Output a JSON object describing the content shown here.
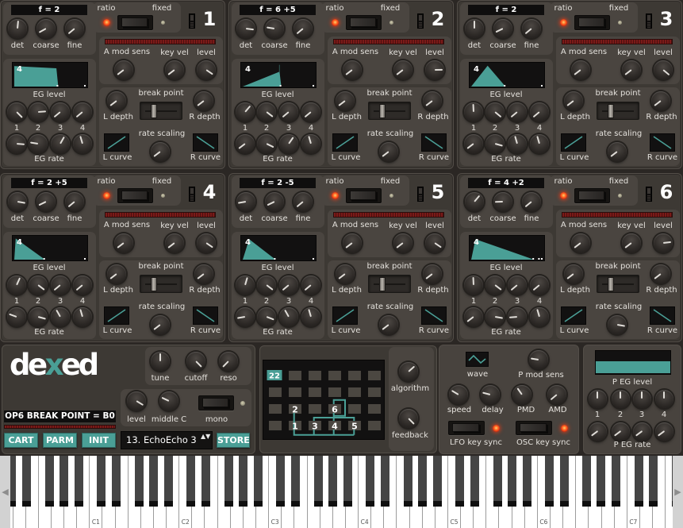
{
  "app": {
    "title": "Dexed"
  },
  "colors": {
    "accent": "#4a9f96",
    "led_on": "#ff4a1e",
    "panel": "#3d3934",
    "subpanel": "#4a4540",
    "display": "#121111"
  },
  "labels": {
    "det": "det",
    "coarse": "coarse",
    "fine": "fine",
    "ratio": "ratio",
    "fixed": "fixed",
    "a_mod_sens": "A mod sens",
    "key_vel": "key vel",
    "level": "level",
    "eg_level": "EG level",
    "eg_rate": "EG rate",
    "stage_numbers": [
      "1",
      "2",
      "3",
      "4"
    ],
    "break_point": "break point",
    "l_depth": "L depth",
    "r_depth": "R depth",
    "rate_scaling": "rate scaling",
    "l_curve": "L curve",
    "r_curve": "R curve"
  },
  "operators": [
    {
      "number": "1",
      "freq_display": "f = 2",
      "mode": "ratio",
      "knobs": {
        "det": 0.52,
        "coarse": 0.06,
        "fine": 0.02,
        "a_mod_sens": 0.03,
        "key_vel": 0.03,
        "level": 0.96,
        "l_depth": 0.03,
        "r_depth": 0.03,
        "rate_scaling": 0.03
      },
      "eg_levels": [
        1.0,
        0.82,
        0.02,
        0.02
      ],
      "eg_rates": [
        0.85,
        0.2,
        0.61,
        0.44
      ],
      "break_point": 0.2,
      "l_curve": "linear-rising",
      "r_curve": "linear-falling",
      "envelope": {
        "stage_label": "4",
        "points": [
          [
            0,
            0
          ],
          [
            0,
            0.92
          ],
          [
            0.59,
            0.82
          ],
          [
            0.615,
            0
          ]
        ],
        "markers": [
          0.615,
          1.0
        ]
      }
    },
    {
      "number": "2",
      "freq_display": "f = 6 +5",
      "mode": "ratio",
      "knobs": {
        "det": 0.86,
        "coarse": 0.2,
        "fine": 0.02,
        "a_mod_sens": 0.03,
        "key_vel": 0.03,
        "level": 0.83,
        "l_depth": 0.03,
        "r_depth": 0.03,
        "rate_scaling": 0.03
      },
      "eg_levels": [
        0.65,
        0.97,
        0.02,
        0.02
      ],
      "eg_rates": [
        0.03,
        0.93,
        0.63,
        0.44
      ],
      "break_point": 0.2,
      "l_curve": "linear-rising",
      "r_curve": "linear-falling",
      "envelope": {
        "stage_label": "4",
        "points": [
          [
            0,
            0
          ],
          [
            0.51,
            0.66
          ],
          [
            0.51,
            0.98
          ],
          [
            0.515,
            0.98
          ],
          [
            0.515,
            0.66
          ],
          [
            0.54,
            0
          ]
        ],
        "markers": [
          0.54,
          1.0
        ]
      }
    },
    {
      "number": "3",
      "freq_display": "f = 2",
      "mode": "ratio",
      "knobs": {
        "det": 0.5,
        "coarse": 0.07,
        "fine": 0.02,
        "a_mod_sens": 0.03,
        "key_vel": 0.03,
        "level": 0.98,
        "l_depth": 0.03,
        "r_depth": 0.03,
        "rate_scaling": 0.03
      },
      "eg_levels": [
        0.49,
        0.98,
        0.02,
        0.02
      ],
      "eg_rates": [
        0.03,
        0.89,
        0.44,
        0.44
      ],
      "break_point": 0.2,
      "l_curve": "linear-rising",
      "r_curve": "linear-falling",
      "envelope": {
        "stage_label": "4",
        "points": [
          [
            0,
            0
          ],
          [
            0.23,
            0.94
          ],
          [
            0.48,
            0
          ]
        ],
        "markers": [
          0.48,
          1.0
        ]
      }
    },
    {
      "number": "4",
      "freq_display": "f = 2 +5",
      "mode": "ratio",
      "knobs": {
        "det": 0.87,
        "coarse": 0.07,
        "fine": 0.02,
        "a_mod_sens": 0.03,
        "key_vel": 0.03,
        "level": 0.96,
        "l_depth": 0.03,
        "r_depth": 0.03,
        "rate_scaling": 0.03
      },
      "eg_levels": [
        0.59,
        0.97,
        0.02,
        0.02
      ],
      "eg_rates": [
        0.24,
        0.89,
        0.39,
        0.44
      ],
      "break_point": 0.2,
      "l_curve": "linear-rising",
      "r_curve": "linear-falling",
      "envelope": {
        "stage_label": "4",
        "points": [
          [
            0,
            0
          ],
          [
            0.02,
            0.95
          ],
          [
            0.43,
            0
          ]
        ],
        "markers": [
          0.43,
          1.0
        ]
      }
    },
    {
      "number": "5",
      "freq_display": "f = 2 -5",
      "mode": "ratio",
      "knobs": {
        "det": 0.13,
        "coarse": 0.07,
        "fine": 0.02,
        "a_mod_sens": 0.03,
        "key_vel": 0.03,
        "level": 0.96,
        "l_depth": 0.03,
        "r_depth": 0.03,
        "rate_scaling": 0.03
      },
      "eg_levels": [
        0.56,
        0.97,
        0.02,
        0.02
      ],
      "eg_rates": [
        0.13,
        0.91,
        0.39,
        0.44
      ],
      "break_point": 0.2,
      "l_curve": "linear-rising",
      "r_curve": "linear-falling",
      "envelope": {
        "stage_label": "4",
        "points": [
          [
            0,
            0
          ],
          [
            0.09,
            0.92
          ],
          [
            0.46,
            0
          ]
        ],
        "markers": [
          0.46,
          1.0
        ]
      }
    },
    {
      "number": "6",
      "freq_display": "f = 4 +2",
      "mode": "ratio",
      "knobs": {
        "det": 0.65,
        "coarse": 0.16,
        "fine": 0.02,
        "a_mod_sens": 0.03,
        "key_vel": 0.03,
        "level": 0.81,
        "l_depth": 0.03,
        "r_depth": 0.03,
        "rate_scaling": 0.87
      },
      "eg_levels": [
        0.49,
        0.97,
        0.02,
        0.02
      ],
      "eg_rates": [
        0.03,
        0.87,
        0.15,
        0.44
      ],
      "break_point": 0.2,
      "l_curve": "linear-rising",
      "r_curve": "linear-falling",
      "envelope": {
        "stage_label": "4",
        "points": [
          [
            0,
            0
          ],
          [
            0.06,
            0.92
          ],
          [
            0.88,
            0
          ]
        ],
        "markers": [
          0.88,
          0.96,
          1.0
        ]
      }
    }
  ],
  "global": {
    "logo_parts": [
      "de",
      "x",
      "ed"
    ],
    "labels": {
      "tune": "tune",
      "cutoff": "cutoff",
      "reso": "reso",
      "level": "level",
      "middle_c": "middle C",
      "mono": "mono"
    },
    "knobs": {
      "tune": 0.5,
      "cutoff": 1.0,
      "reso": 0.0,
      "level": 0.95,
      "middle_c": 0.26
    },
    "mono_on": false,
    "status": "OP6 BREAK POINT = B0",
    "buttons": {
      "cart": "CART",
      "parm": "PARM",
      "init": "INIT",
      "store": "STORE"
    },
    "program": "13. EchoEcho 3",
    "program_stepper_icon": "▲▼"
  },
  "algorithm": {
    "number": "22",
    "operators": [
      "1",
      "2",
      "3",
      "4",
      "5",
      "6"
    ],
    "labels": {
      "algorithm": "algorithm",
      "feedback": "feedback"
    },
    "knobs": {
      "algorithm": 0.68,
      "feedback": 1.0
    }
  },
  "lfo": {
    "wave": "triangle",
    "labels": {
      "wave": "wave",
      "p_mod_sens": "P mod sens",
      "speed": "speed",
      "delay": "delay",
      "pmd": "PMD",
      "amd": "AMD",
      "lfo_key_sync": "LFO key sync",
      "osc_key_sync": "OSC key sync"
    },
    "knobs": {
      "p_mod_sens": 0.2,
      "speed": 0.28,
      "delay": 0.22,
      "pmd": 0.37,
      "amd": 0.02
    },
    "lfo_key_sync": true,
    "osc_key_sync": true
  },
  "pitch_eg": {
    "labels": {
      "level": "P EG level",
      "rate": "P EG rate",
      "numbers": [
        "1",
        "2",
        "3",
        "4"
      ]
    },
    "levels": [
      0.5,
      0.5,
      0.5,
      0.5
    ],
    "rates": [
      0.03,
      0.03,
      0.03,
      0.03
    ],
    "display_level": 0.55
  },
  "keyboard": {
    "octave_labels": [
      "C1",
      "C2",
      "C3",
      "C4",
      "C5",
      "C6",
      "C7"
    ],
    "scroll_left_icon": "◀",
    "scroll_right_icon": "▶"
  }
}
